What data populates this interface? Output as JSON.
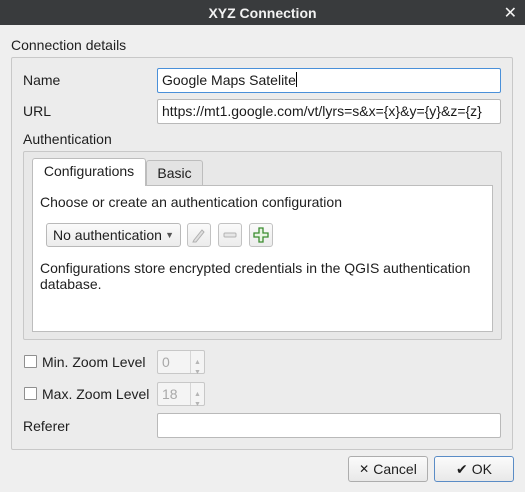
{
  "window": {
    "title": "XYZ Connection",
    "close_glyph": "✕"
  },
  "group": {
    "title": "Connection details"
  },
  "fields": {
    "name_label": "Name",
    "name_value": "Google Maps Satelite",
    "url_label": "URL",
    "url_value": "https://mt1.google.com/vt/lyrs=s&x={x}&y={y}&z={z}"
  },
  "auth": {
    "title": "Authentication",
    "tabs": [
      "Configurations",
      "Basic"
    ],
    "choose_text": "Choose or create an authentication configuration",
    "combo_value": "No authentication",
    "info_text": "Configurations store encrypted credentials in the QGIS authentication database."
  },
  "zoom": {
    "min_label": "Min. Zoom Level",
    "min_value": "0",
    "max_label": "Max. Zoom Level",
    "max_value": "18"
  },
  "referer": {
    "label": "Referer",
    "value": ""
  },
  "buttons": {
    "cancel": "Cancel",
    "ok": "OK"
  },
  "icons": {
    "close": "close-icon",
    "edit": "pencil-icon",
    "remove": "minus-icon",
    "add": "plus-icon",
    "cancel": "x-icon",
    "ok": "check-icon"
  },
  "colors": {
    "titlebar": "#393b3d",
    "add_icon": "#3a8c2f",
    "focus": "#4a90d9"
  }
}
